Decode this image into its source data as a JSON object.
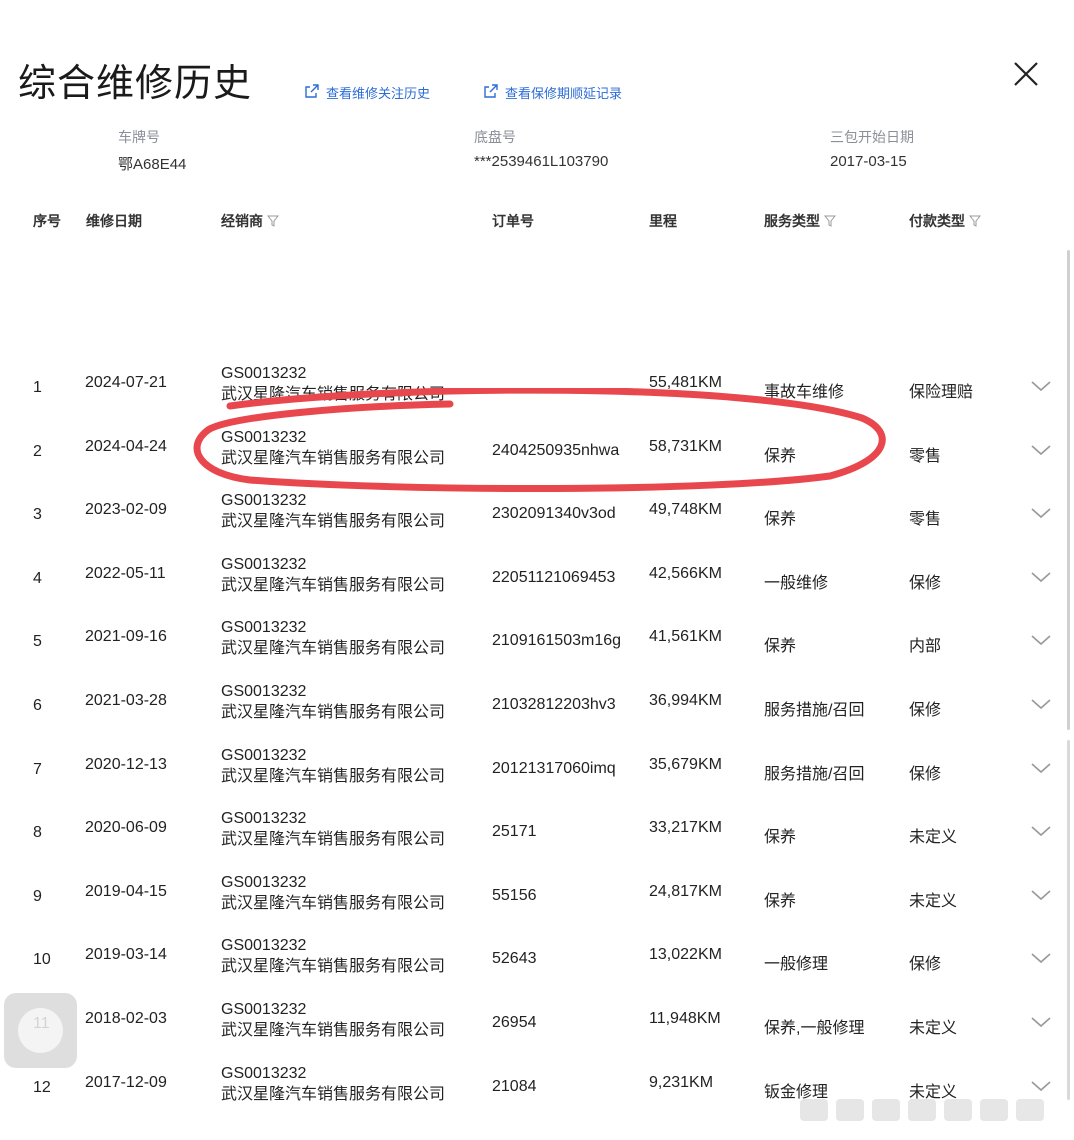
{
  "header": {
    "title": "综合维修历史",
    "link1": "查看维修关注历史",
    "link2": "查看保修期顺延记录"
  },
  "info": {
    "plate_label": "车牌号",
    "plate_value": "鄂A68E44",
    "vin_label": "底盘号",
    "vin_value": "***2539461L103790",
    "warranty_label": "三包开始日期",
    "warranty_value": "2017-03-15"
  },
  "columns": {
    "seq": "序号",
    "date": "维修日期",
    "dealer": "经销商",
    "order": "订单号",
    "mileage": "里程",
    "service": "服务类型",
    "payment": "付款类型"
  },
  "rows": [
    {
      "seq": "1",
      "date": "2024-07-21",
      "dealer_code": "GS0013232",
      "dealer_name": "武汉星隆汽车销售服务有限公司",
      "order": "",
      "mileage": "55,481KM",
      "service": "事故车维修",
      "payment": "保险理赔"
    },
    {
      "seq": "2",
      "date": "2024-04-24",
      "dealer_code": "GS0013232",
      "dealer_name": "武汉星隆汽车销售服务有限公司",
      "order": "2404250935nhwa",
      "mileage": "58,731KM",
      "service": "保养",
      "payment": "零售"
    },
    {
      "seq": "3",
      "date": "2023-02-09",
      "dealer_code": "GS0013232",
      "dealer_name": "武汉星隆汽车销售服务有限公司",
      "order": "2302091340v3od",
      "mileage": "49,748KM",
      "service": "保养",
      "payment": "零售"
    },
    {
      "seq": "4",
      "date": "2022-05-11",
      "dealer_code": "GS0013232",
      "dealer_name": "武汉星隆汽车销售服务有限公司",
      "order": "22051121069453",
      "mileage": "42,566KM",
      "service": "一般维修",
      "payment": "保修"
    },
    {
      "seq": "5",
      "date": "2021-09-16",
      "dealer_code": "GS0013232",
      "dealer_name": "武汉星隆汽车销售服务有限公司",
      "order": "2109161503m16g",
      "mileage": "41,561KM",
      "service": "保养",
      "payment": "内部"
    },
    {
      "seq": "6",
      "date": "2021-03-28",
      "dealer_code": "GS0013232",
      "dealer_name": "武汉星隆汽车销售服务有限公司",
      "order": "21032812203hv3",
      "mileage": "36,994KM",
      "service": "服务措施/召回",
      "payment": "保修"
    },
    {
      "seq": "7",
      "date": "2020-12-13",
      "dealer_code": "GS0013232",
      "dealer_name": "武汉星隆汽车销售服务有限公司",
      "order": "20121317060imq",
      "mileage": "35,679KM",
      "service": "服务措施/召回",
      "payment": "保修"
    },
    {
      "seq": "8",
      "date": "2020-06-09",
      "dealer_code": "GS0013232",
      "dealer_name": "武汉星隆汽车销售服务有限公司",
      "order": "25171",
      "mileage": "33,217KM",
      "service": "保养",
      "payment": "未定义"
    },
    {
      "seq": "9",
      "date": "2019-04-15",
      "dealer_code": "GS0013232",
      "dealer_name": "武汉星隆汽车销售服务有限公司",
      "order": "55156",
      "mileage": "24,817KM",
      "service": "保养",
      "payment": "未定义"
    },
    {
      "seq": "10",
      "date": "2019-03-14",
      "dealer_code": "GS0013232",
      "dealer_name": "武汉星隆汽车销售服务有限公司",
      "order": "52643",
      "mileage": "13,022KM",
      "service": "一般修理",
      "payment": "保修"
    },
    {
      "seq": "11",
      "date": "2018-02-03",
      "dealer_code": "GS0013232",
      "dealer_name": "武汉星隆汽车销售服务有限公司",
      "order": "26954",
      "mileage": "11,948KM",
      "service": "保养,一般修理",
      "payment": "未定义"
    },
    {
      "seq": "12",
      "date": "2017-12-09",
      "dealer_code": "GS0013232",
      "dealer_name": "武汉星隆汽车销售服务有限公司",
      "order": "21084",
      "mileage": "9,231KM",
      "service": "钣金修理",
      "payment": "未定义"
    }
  ],
  "colors": {
    "link": "#2b6cd6",
    "annotation": "#e8474d"
  }
}
